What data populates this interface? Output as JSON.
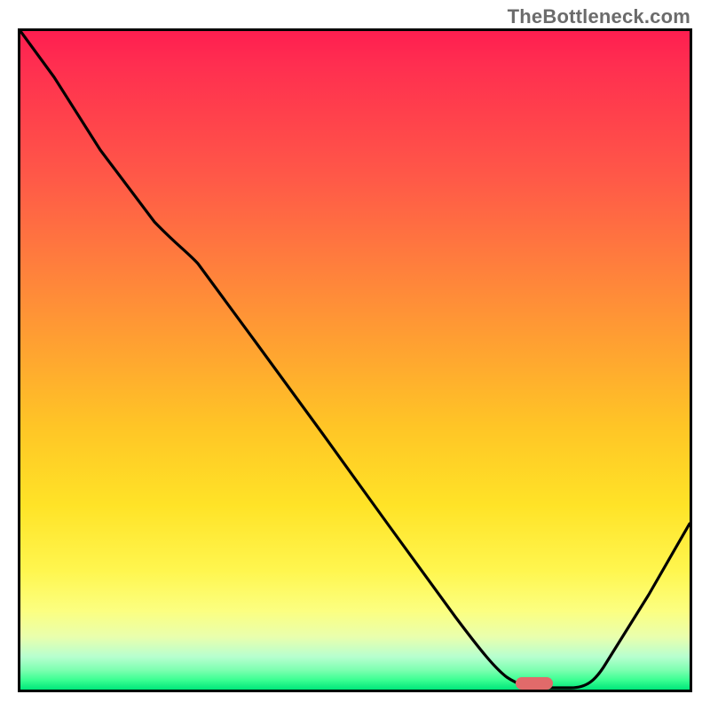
{
  "attribution": "TheBottleneck.com",
  "colors": {
    "border": "#000000",
    "marker": "#e16a6a",
    "gradient_top": "#ff1e50",
    "gradient_mid": "#ffe327",
    "gradient_bottom": "#00e67a"
  },
  "chart_data": {
    "type": "line",
    "title": "",
    "xlabel": "",
    "ylabel": "",
    "xlim": [
      0,
      1
    ],
    "ylim": [
      0,
      1
    ],
    "x": [
      0.0,
      0.05,
      0.12,
      0.2,
      0.25,
      0.35,
      0.45,
      0.55,
      0.65,
      0.72,
      0.78,
      0.82,
      0.88,
      0.94,
      1.0
    ],
    "values": [
      1.0,
      0.93,
      0.82,
      0.71,
      0.67,
      0.53,
      0.39,
      0.25,
      0.11,
      0.03,
      0.0,
      0.0,
      0.05,
      0.14,
      0.25
    ],
    "marker": {
      "x": 0.765,
      "y": 0.0,
      "width_frac": 0.05
    },
    "notes": "Background is a vertical gradient from red (high y) to green (y=0); curve dips to zero near x≈0.78 then rises."
  }
}
